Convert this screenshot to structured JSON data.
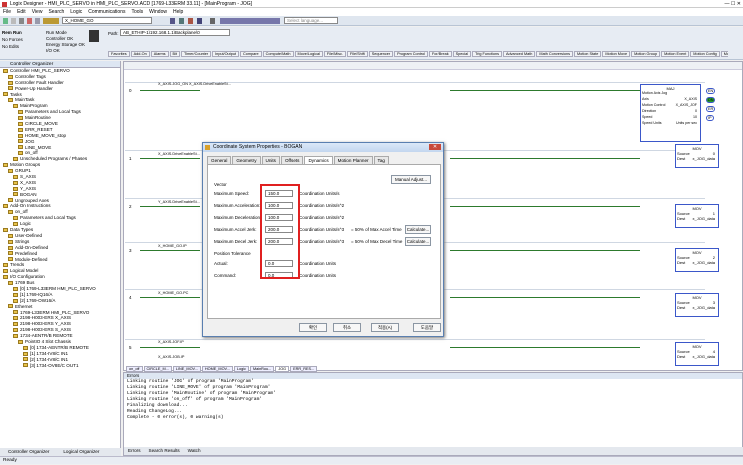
{
  "title": "Logix Designer - HMI_PLC_SERVO in HMI_PLC_SERVO.ACD [1769-L33ERM 33.11] - [MainProgram - JOG]",
  "menu": [
    "File",
    "Edit",
    "View",
    "Search",
    "Logic",
    "Communications",
    "Tools",
    "Window",
    "Help"
  ],
  "toolbar": {
    "tag_combo": "X_HOME_GO",
    "path_label": "Path:",
    "path_value": "AB_ETHIP-1\\192.168.1.1\\Backplane\\0",
    "language_placeholder": "Select language..."
  },
  "status_panel": {
    "mode": "Rem Run",
    "forces": "No Forces",
    "edits": "No Edits",
    "run_mode": "Run Mode",
    "controller_ok": "Controller OK",
    "energy": "Energy Storage OK",
    "io_ok": "I/O OK"
  },
  "instr_tabs": [
    "Favorites",
    "Add-On",
    "Alarms",
    "Bit",
    "Timer/Counter",
    "Input/Output",
    "Compare",
    "Compute/Math",
    "Move/Logical",
    "File/Misc.",
    "File/Shift",
    "Sequencer",
    "Program Control",
    "For/Break",
    "Special",
    "Trig Functions",
    "Advanced Math",
    "Math Conversions",
    "Motion State",
    "Motion Move",
    "Motion Group",
    "Motion Event",
    "Motion Config",
    "Motion Coordinated"
  ],
  "organizer": {
    "title": "Controller Organizer",
    "items": [
      "Controller HMI_PLC_SERVO",
      "Controller Tags",
      "Controller Fault Handler",
      "Power-Up Handler",
      "Tasks",
      "MainTask",
      "MainProgram",
      "Parameters and Local Tags",
      "MainRoutine",
      "CIRCLE_MOVE",
      "ERR_RESET",
      "HOME_MOVE_stop",
      "JOG",
      "LINE_MOVE",
      "on_off",
      "Unscheduled Programs / Phases",
      "Motion Groups",
      "GRUP1",
      "S_AXIS",
      "X_AXIS",
      "Y_AXIS",
      "BOGAN",
      "Ungrouped Axes",
      "Add-On Instructions",
      "on_off",
      "Parameters and Local Tags",
      "Logic",
      "Data Types",
      "User-Defined",
      "Strings",
      "Add-On-Defined",
      "Predefined",
      "Module-Defined",
      "Trends",
      "Logical Model",
      "I/O Configuration",
      "1769 Bus",
      "[0] 1769-L33ERM HMI_PLC_SERVO",
      "[1] 1769-IQ16/A",
      "[2] 1769-OW16/A",
      "Ethernet",
      "1769-L33ERM HMI_PLC_SERVO",
      "2198-H003-ERS X_AXIS",
      "2198-H003-ERS Y_AXIS",
      "2198-H003-ERS S_AXIS",
      "1734-AENTR/B REMOTE",
      "PointIO 4 Slot Chassis",
      "[0] 1734-AENTR/B REMOTE",
      "[1] 1734-IV8/C IN1",
      "[2] 1734-IV8/C IN1",
      "[3] 1734-OV8E/C OUT1"
    ],
    "tabs": [
      "Controller Organizer",
      "Logical Organizer"
    ]
  },
  "ladder": {
    "rungs": [
      "0",
      "1",
      "2",
      "3",
      "4",
      "5"
    ],
    "labels": [
      "X_AXIS.JOG_ON  X_AXIS.DriveEnableSt...",
      "X_AXIS.DriveEnableSt...",
      "Y_AXIS.DriveEnableSt...",
      "X_HOME_GO.IP",
      "X_HOME_GO.PC",
      "X_AXIS.JOF.IP",
      "X_AXIS.JOB.IP"
    ],
    "mam": {
      "title": "MAJ",
      "rows": [
        "Motion Axis Jog",
        "Axis",
        "Motion Control",
        "Direction",
        "Speed",
        "Speed Units"
      ],
      "vals": [
        "",
        "X_AXIS",
        "X_AXIS_JOF",
        "0",
        "10",
        "Units per sec"
      ],
      "outs": [
        "EN",
        "DN",
        "ER",
        "IP"
      ]
    },
    "mov": {
      "title": "MOV",
      "src": "Source",
      "dest": "Dest",
      "dest_val": "x_JOG_data",
      "srcs": [
        "0",
        "1",
        "2",
        "3",
        "4"
      ]
    },
    "bottom_tabs": [
      "on_off",
      "CIRCLE_M...",
      "LINE_MOV...",
      "HOME_MOV...",
      "Logic",
      "MainRou...",
      "JOG",
      "ERR_RES..."
    ]
  },
  "dialog": {
    "title": "Coordinate System Properties - BOGAN",
    "tabs": [
      "General",
      "Geometry",
      "Units",
      "Offsets",
      "Dynamics",
      "Motion Planner",
      "Tag"
    ],
    "active_tab": "Dynamics",
    "manual_adjust": "Manual Adjust...",
    "vector": "Vector",
    "rows": [
      {
        "label": "Maximum Speed:",
        "value": "150.0",
        "unit": "Coordination Units/s"
      },
      {
        "label": "Maximum Acceleration:",
        "value": "100.0",
        "unit": "Coordination Units/s^2"
      },
      {
        "label": "Maximum Deceleration:",
        "value": "100.0",
        "unit": "Coordination Units/s^2"
      },
      {
        "label": "Maximum Accel Jerk:",
        "value": "200.0",
        "unit": "Coordination Units/s^3",
        "pct": "= 50% of Max Accel Time",
        "btn": "Calculate..."
      },
      {
        "label": "Maximum Decel Jerk:",
        "value": "200.0",
        "unit": "Coordination Units/s^3",
        "pct": "= 50% of Max Decel Time",
        "btn": "Calculate..."
      }
    ],
    "position_tolerance": "Position Tolerance",
    "tol_rows": [
      {
        "label": "Actual:",
        "value": "0.0",
        "unit": "Coordination Units"
      },
      {
        "label": "Command:",
        "value": "0.0",
        "unit": "Coordination Units"
      }
    ],
    "buttons": [
      "확인",
      "취소",
      "적용(A)",
      "도움말"
    ]
  },
  "errors": {
    "title": "Errors",
    "lines": [
      "Linking routine 'JOG' of program 'MainProgram'",
      "Linking routine 'LINE_MOVE' of program 'MainProgram'",
      "Linking routine 'MainRoutine' of program 'MainProgram'",
      "Linking routine 'on_off' of program 'MainProgram'",
      "Finalizing download...",
      "Reading ChangeLog...",
      "Complete - 0 error(s), 0 warning(s)"
    ],
    "tabs": [
      "Errors",
      "Search Results",
      "Watch"
    ]
  },
  "statusbar": "Ready"
}
